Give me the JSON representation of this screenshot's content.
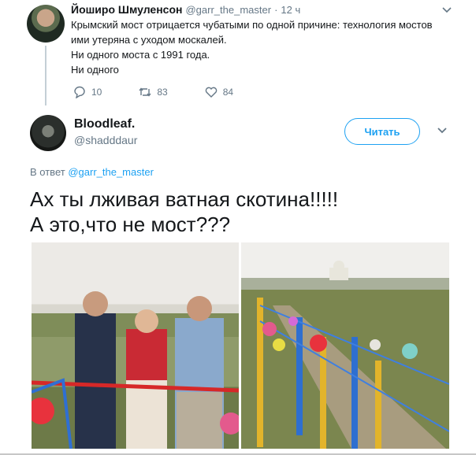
{
  "tweet1": {
    "author": "Йоширо Шмуленсон",
    "handle": "@garr_the_master",
    "separator": "·",
    "time": "12 ч",
    "lines": [
      "Крымский мост отрицается чубатыми по одной причине: технология мостов",
      "ими утеряна с уходом москалей.",
      "Ни одного моста с 1991 года.",
      "Ни одного"
    ],
    "actions": {
      "replies": "10",
      "retweets": "83",
      "likes": "84"
    }
  },
  "tweet2": {
    "author": "Bloodleaf.",
    "handle": "@shadddaur",
    "follow_label": "Читать",
    "reply_prefix": "В ответ",
    "reply_to": "@garr_the_master",
    "lines": [
      "Ах ты лживая ватная скотина!!!!!",
      "А это,что не мост???"
    ]
  },
  "colors": {
    "accent": "#1da1f2",
    "muted": "#657786",
    "text": "#14171a"
  },
  "icons": [
    "reply-icon",
    "retweet-icon",
    "like-icon",
    "chevron-down-icon",
    "more-icon"
  ]
}
